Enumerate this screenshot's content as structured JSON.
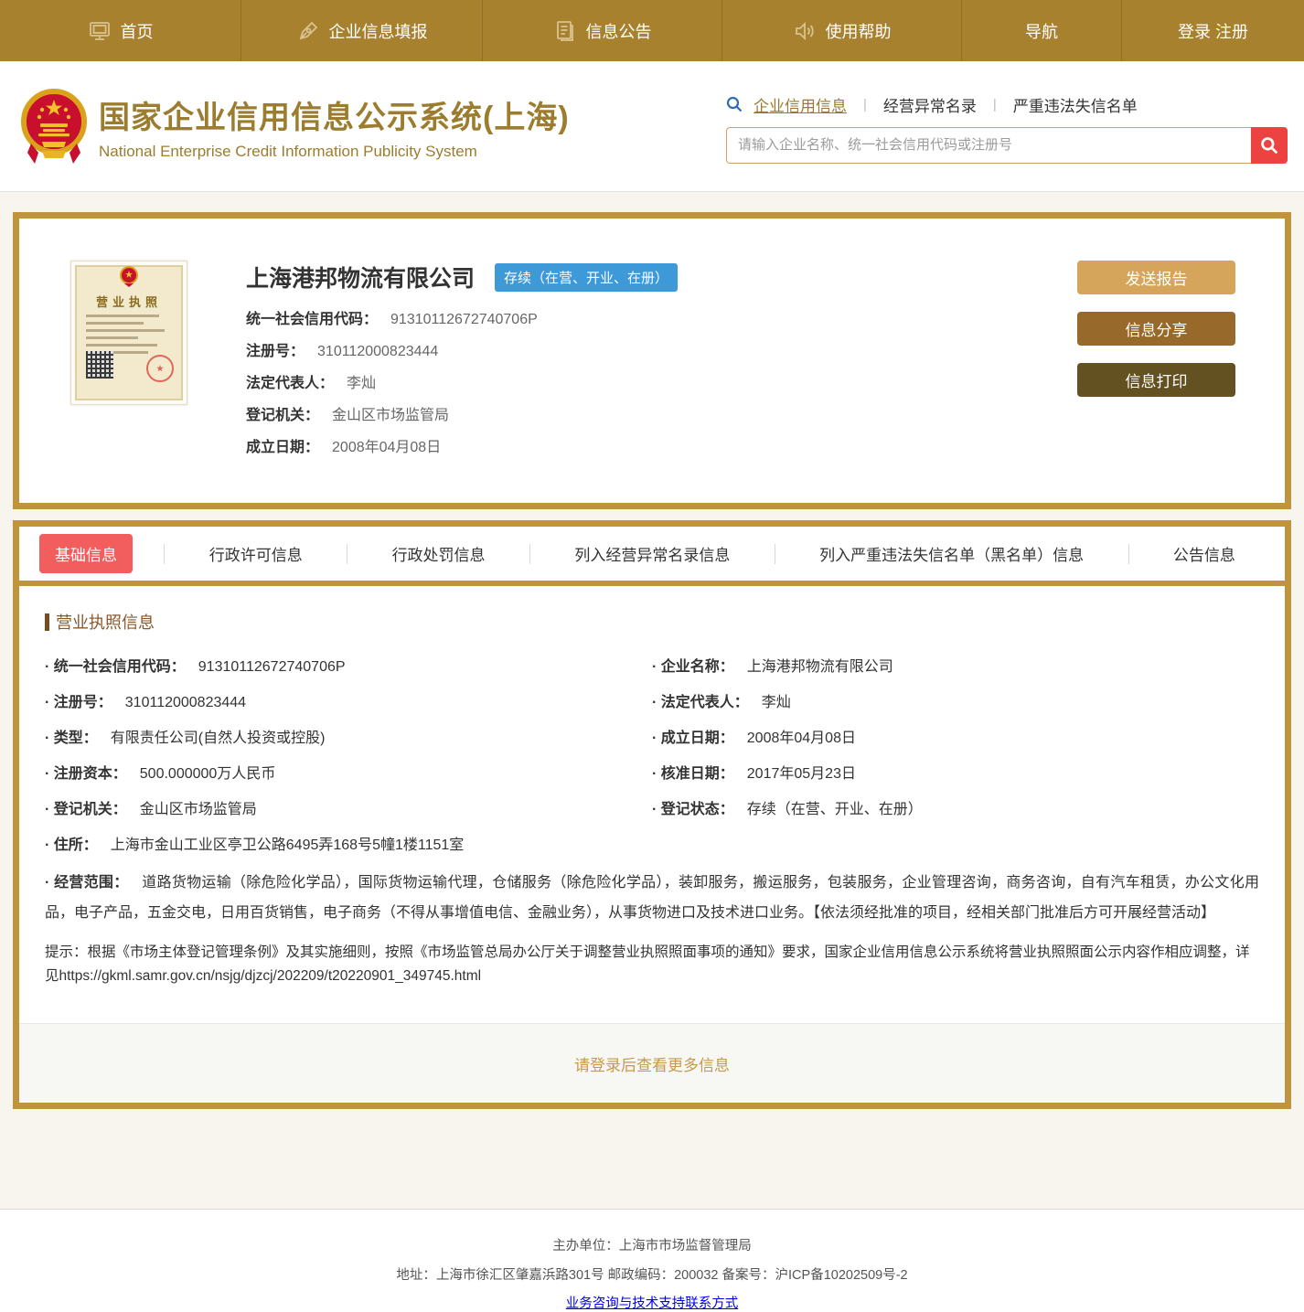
{
  "nav": {
    "items": [
      {
        "label": "首页"
      },
      {
        "label": "企业信息填报"
      },
      {
        "label": "信息公告"
      },
      {
        "label": "使用帮助"
      },
      {
        "label": "导航"
      },
      {
        "label": "登录 注册"
      }
    ]
  },
  "header": {
    "title": "国家企业信用信息公示系统(上海)",
    "subtitle": "National Enterprise Credit Information Publicity System",
    "search_tabs": [
      "企业信用信息",
      "经营异常名录",
      "严重违法失信名单"
    ],
    "search_placeholder": "请输入企业名称、统一社会信用代码或注册号"
  },
  "company": {
    "name": "上海港邦物流有限公司",
    "status": "存续（在营、开业、在册）",
    "license_thumb_title": "营业执照",
    "fields": [
      {
        "label": "统一社会信用代码：",
        "value": "91310112672740706P"
      },
      {
        "label": "注册号：",
        "value": "310112000823444"
      },
      {
        "label": "法定代表人：",
        "value": "李灿"
      },
      {
        "label": "登记机关：",
        "value": "金山区市场监管局"
      },
      {
        "label": "成立日期：",
        "value": "2008年04月08日"
      }
    ],
    "buttons": [
      "发送报告",
      "信息分享",
      "信息打印"
    ]
  },
  "tabs": [
    "基础信息",
    "行政许可信息",
    "行政处罚信息",
    "列入经营异常名录信息",
    "列入严重违法失信名单（黑名单）信息",
    "公告信息"
  ],
  "license_section": {
    "title": "营业执照信息",
    "left_fields": [
      {
        "label": "· 统一社会信用代码：",
        "value": "91310112672740706P"
      },
      {
        "label": "· 注册号：",
        "value": "310112000823444"
      },
      {
        "label": "· 类型：",
        "value": "有限责任公司(自然人投资或控股)"
      },
      {
        "label": "· 注册资本：",
        "value": "500.000000万人民币"
      },
      {
        "label": "· 登记机关：",
        "value": "金山区市场监管局"
      }
    ],
    "right_fields": [
      {
        "label": "· 企业名称：",
        "value": "上海港邦物流有限公司"
      },
      {
        "label": "· 法定代表人：",
        "value": "李灿"
      },
      {
        "label": "· 成立日期：",
        "value": "2008年04月08日"
      },
      {
        "label": "· 核准日期：",
        "value": "2017年05月23日"
      },
      {
        "label": "· 登记状态：",
        "value": "存续（在营、开业、在册）"
      }
    ],
    "address": {
      "label": "· 住所：",
      "value": "上海市金山工业区亭卫公路6495弄168号5幢1楼1151室"
    },
    "scope": {
      "label": "· 经营范围：",
      "value": "道路货物运输（除危险化学品），国际货物运输代理，仓储服务（除危险化学品），装卸服务，搬运服务，包装服务，企业管理咨询，商务咨询，自有汽车租赁，办公文化用品，电子产品，五金交电，日用百货销售，电子商务（不得从事增值电信、金融业务），从事货物进口及技术进口业务。【依法须经批准的项目，经相关部门批准后方可开展经营活动】"
    },
    "tip": "提示：根据《市场主体登记管理条例》及其实施细则，按照《市场监管总局办公厅关于调整营业执照照面事项的通知》要求，国家企业信用信息公示系统将营业执照照面公示内容作相应调整，详见https://gkml.samr.gov.cn/nsjg/djzcj/202209/t20220901_349745.html",
    "login_more": "请登录后查看更多信息"
  },
  "footer": {
    "line1": "主办单位：上海市市场监督管理局",
    "line2": "地址：上海市徐汇区肇嘉浜路301号  邮政编码：200032  备案号：沪ICP备10202509号-2",
    "link": "业务咨询与技术支持联系方式"
  },
  "colors": {
    "nav_gold": "#a8812f",
    "card_border": "#c0943c",
    "badge_blue": "#3e99d8",
    "active_tab_red": "#f25e5e",
    "search_button_red": "#ec4340",
    "btn_send": "#d4a55a",
    "btn_share": "#976a2b",
    "btn_print": "#645122"
  }
}
